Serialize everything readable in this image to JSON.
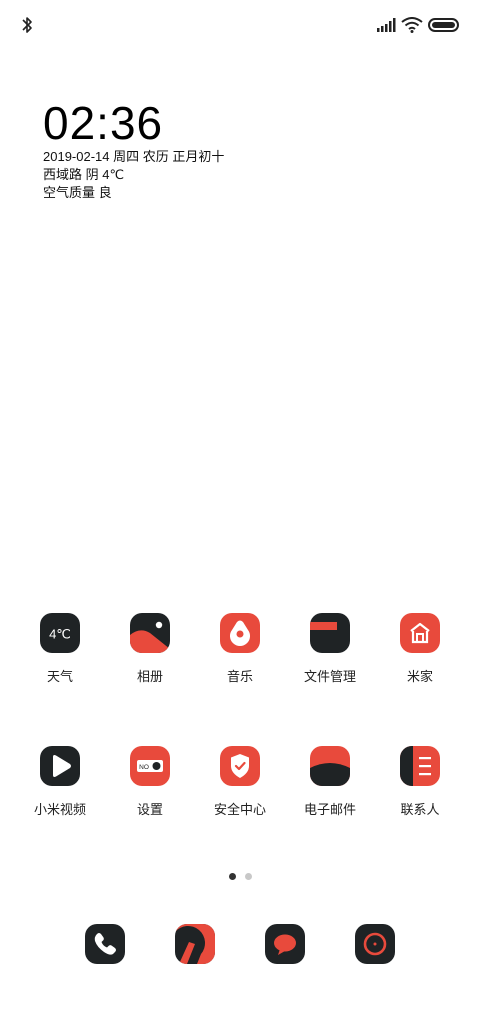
{
  "status_bar": {
    "bluetooth_icon": "bluetooth-icon",
    "signal_icon": "cell-signal-icon",
    "wifi_icon": "wifi-icon",
    "battery_icon": "battery-icon"
  },
  "widget": {
    "time": "02:36",
    "date_line": "2019-02-14 周四 农历 正月初十",
    "weather_line": "西域路 阴 4℃",
    "air_line": "空气质量 良"
  },
  "apps": [
    {
      "label": "天气",
      "icon_text": "4℃",
      "icon": "weather-icon"
    },
    {
      "label": "相册",
      "icon": "gallery-icon"
    },
    {
      "label": "音乐",
      "icon": "music-icon"
    },
    {
      "label": "文件管理",
      "icon": "file-manager-icon"
    },
    {
      "label": "米家",
      "icon": "mi-home-icon"
    },
    {
      "label": "小米视频",
      "icon": "mi-video-icon"
    },
    {
      "label": "设置",
      "icon_text": "NO",
      "icon": "settings-icon"
    },
    {
      "label": "安全中心",
      "icon": "security-center-icon"
    },
    {
      "label": "电子邮件",
      "icon": "email-icon"
    },
    {
      "label": "联系人",
      "icon": "contacts-icon"
    }
  ],
  "pager": {
    "current_page": 1,
    "page_count": 2
  },
  "dock": [
    {
      "icon": "phone-icon"
    },
    {
      "icon": "browser-icon"
    },
    {
      "icon": "messages-icon"
    },
    {
      "icon": "camera-icon"
    }
  ],
  "colors": {
    "accent_red": "#e84a3c",
    "icon_dark": "#1f2325",
    "background": "#ffffff"
  }
}
